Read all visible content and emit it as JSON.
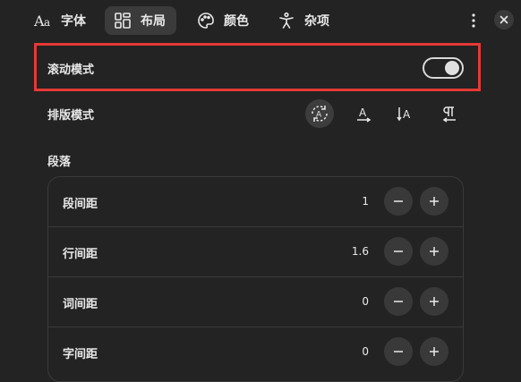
{
  "tabs": [
    {
      "label": "字体",
      "icon": "font-icon",
      "active": false
    },
    {
      "label": "布局",
      "icon": "layout-grid-icon",
      "active": true
    },
    {
      "label": "颜色",
      "icon": "palette-icon",
      "active": false
    },
    {
      "label": "杂项",
      "icon": "accessibility-icon",
      "active": false
    }
  ],
  "header": {
    "more_icon": "more-vertical-icon",
    "close_icon": "close-icon"
  },
  "scroll_mode": {
    "label": "滚动模式",
    "enabled": true
  },
  "typesetting": {
    "label": "排版模式",
    "modes": [
      "auto-direction-icon",
      "horizontal-text-icon",
      "vertical-text-icon",
      "rtl-text-icon"
    ],
    "selected_index": 0
  },
  "paragraph": {
    "title": "段落",
    "rows": [
      {
        "label": "段间距",
        "value": "1"
      },
      {
        "label": "行间距",
        "value": "1.6"
      },
      {
        "label": "词间距",
        "value": "0"
      },
      {
        "label": "字间距",
        "value": "0"
      }
    ]
  },
  "colors": {
    "accent_border": "#e53935",
    "background": "#232323"
  }
}
